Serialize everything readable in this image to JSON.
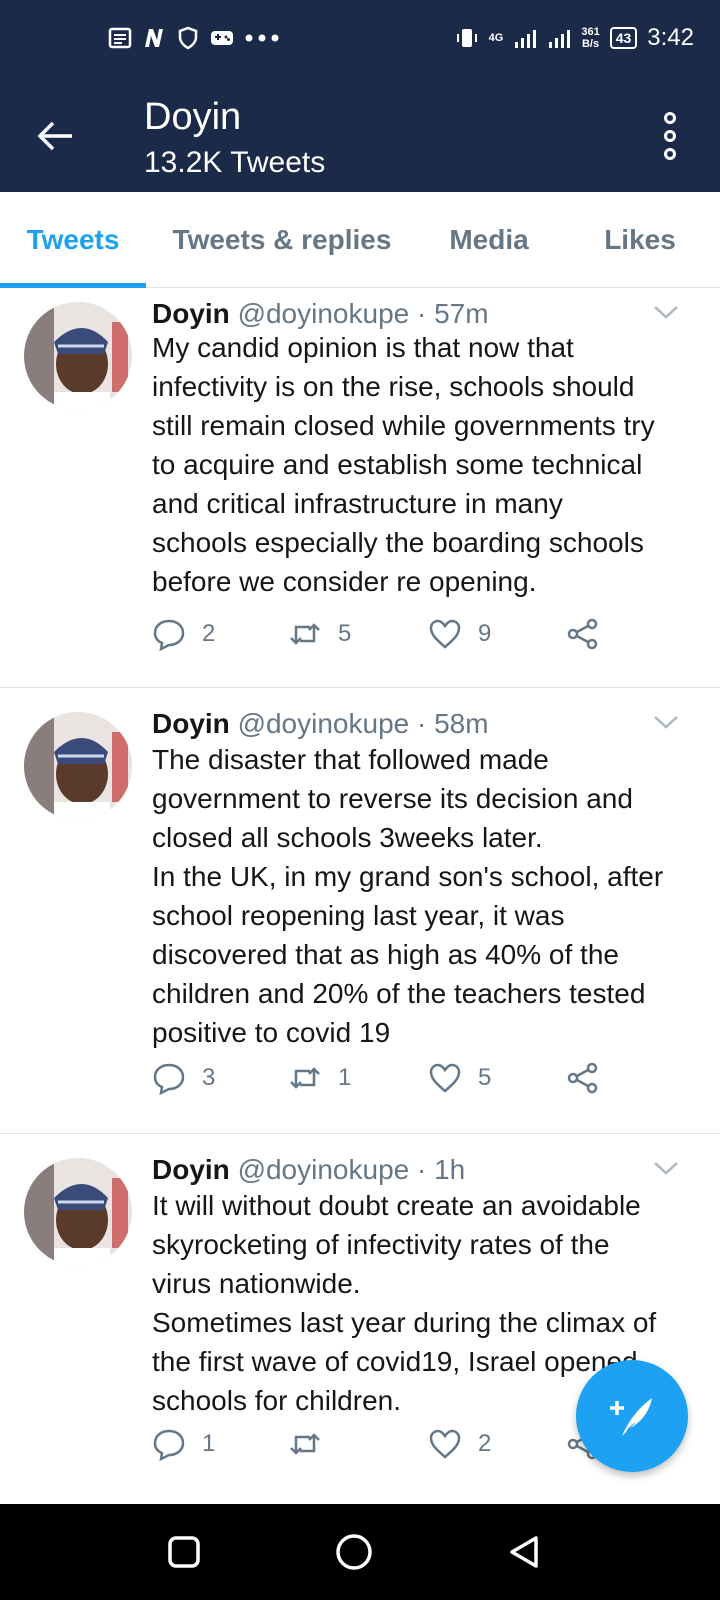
{
  "status_bar": {
    "network": "4G",
    "speed_value": "361",
    "speed_unit": "B/s",
    "battery": "43",
    "time": "3:42"
  },
  "header": {
    "title": "Doyin",
    "subtitle": "13.2K Tweets"
  },
  "tabs": [
    {
      "label": "Tweets",
      "active": true
    },
    {
      "label": "Tweets & replies",
      "active": false
    },
    {
      "label": "Media",
      "active": false
    },
    {
      "label": "Likes",
      "active": false
    }
  ],
  "tweets": [
    {
      "name": "Doyin",
      "handle": "@doyinokupe",
      "time": "· 57m",
      "text": "My candid opinion is that now that\ninfectivity is on the rise, schools should\nstill remain closed while governments try\nto acquire and establish some technical\nand critical infrastructure in many\nschools especially the boarding schools\nbefore we consider re opening.",
      "replies": "2",
      "retweets": "5",
      "likes": "9"
    },
    {
      "name": "Doyin",
      "handle": "@doyinokupe",
      "time": "· 58m",
      "text": "The disaster that followed made\ngovernment to reverse its decision and\nclosed all schools 3weeks later.\nIn the UK, in my grand son's school, after\nschool reopening last year, it was\ndiscovered that as high as 40% of the\nchildren and 20% of the teachers tested\npositive to covid 19",
      "replies": "3",
      "retweets": "1",
      "likes": "5"
    },
    {
      "name": "Doyin",
      "handle": "@doyinokupe",
      "time": "· 1h",
      "text": "It will without doubt create an avoidable\nskyrocketing of infectivity rates of the\nvirus nationwide.\nSometimes last year during the climax of\nthe first wave of covid19, Israel opened\nschools for children.",
      "replies": "1",
      "retweets": "",
      "likes": "2"
    }
  ],
  "colors": {
    "header_bg": "#1b2a48",
    "accent": "#1da1f2",
    "muted": "#657786"
  }
}
